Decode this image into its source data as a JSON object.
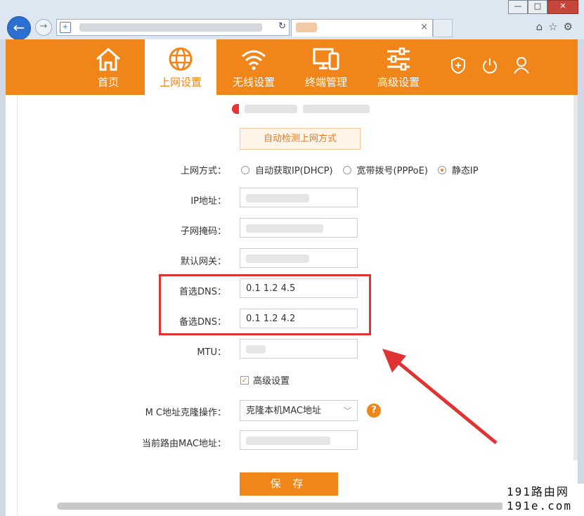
{
  "browser": {
    "back_icon": "back-arrow-icon",
    "forward_icon": "forward-arrow-icon",
    "window_min": "—",
    "window_max": "□",
    "window_close": "✕",
    "tab_close": "×",
    "refresh": "↻"
  },
  "nav": {
    "items": [
      {
        "label": "首页",
        "icon": "home-icon"
      },
      {
        "label": "上网设置",
        "icon": "globe-icon"
      },
      {
        "label": "无线设置",
        "icon": "wifi-icon"
      },
      {
        "label": "终端管理",
        "icon": "devices-icon"
      },
      {
        "label": "高级设置",
        "icon": "sliders-icon"
      }
    ],
    "active_index": 1
  },
  "page": {
    "detect_button": "自动检测上网方式",
    "mode_label": "上网方式：",
    "modes": [
      {
        "label": "自动获取IP(DHCP)",
        "checked": false
      },
      {
        "label": "宽带拨号(PPPoE)",
        "checked": false
      },
      {
        "label": "静态IP",
        "checked": true
      }
    ],
    "ip_label": "IP地址：",
    "mask_label": "子网掩码：",
    "gateway_label": "默认网关：",
    "dns1_label": "首选DNS：",
    "dns1_value": "0.1  1.2  4.5",
    "dns2_label": "备选DNS：",
    "dns2_value": "0.1  1.2  4.2",
    "mtu_label": "MTU：",
    "advanced_checkbox": "高级设置",
    "mac_clone_label": "M  C地址克隆操作：",
    "mac_clone_value": "克隆本机MAC地址",
    "current_mac_label": "当前路由MAC地址：",
    "save_button": "保 存"
  },
  "watermark": {
    "line1": "191路由网",
    "line2": "191e.com"
  },
  "colors": {
    "brand": "#f08519",
    "highlight": "#e03434"
  }
}
